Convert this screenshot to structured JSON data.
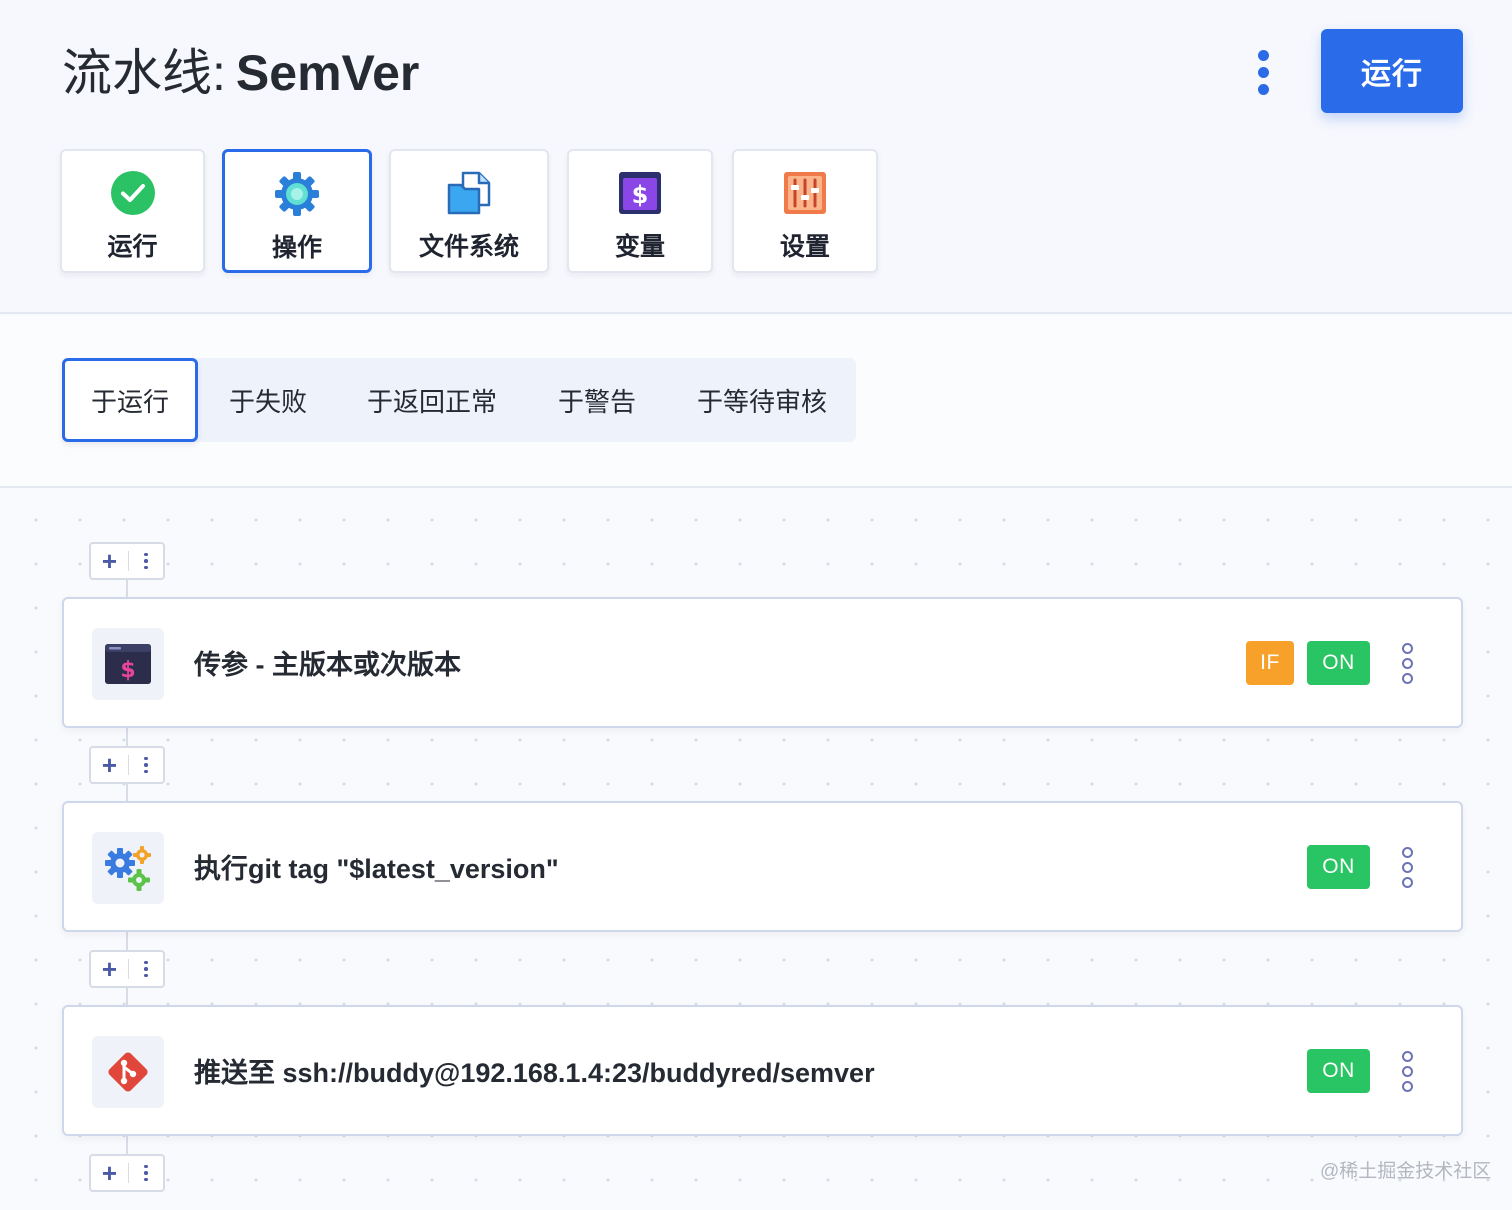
{
  "header": {
    "title_prefix": "流水线:",
    "title_name": "SemVer",
    "run_button": "运行",
    "more_icon": "kebab-vertical-icon"
  },
  "top_tabs": [
    {
      "label": "运行",
      "icon": "check-circle-icon",
      "active": false
    },
    {
      "label": "操作",
      "icon": "gear-icon",
      "active": true
    },
    {
      "label": "文件系统",
      "icon": "files-icon",
      "active": false
    },
    {
      "label": "变量",
      "icon": "dollar-icon",
      "active": false
    },
    {
      "label": "设置",
      "icon": "sliders-icon",
      "active": false
    }
  ],
  "trigger_tabs": [
    {
      "label": "于运行",
      "active": true
    },
    {
      "label": "于失败",
      "active": false
    },
    {
      "label": "于返回正常",
      "active": false
    },
    {
      "label": "于警告",
      "active": false
    },
    {
      "label": "于等待审核",
      "active": false
    }
  ],
  "actions": [
    {
      "name": "传参 - 主版本或次版本",
      "icon": "terminal-dollar-icon",
      "if_badge": "IF",
      "on_badge": "ON"
    },
    {
      "name": "执行git tag \"$latest_version\"",
      "icon": "gears-icon",
      "if_badge": null,
      "on_badge": "ON"
    },
    {
      "name": "推送至 ssh://buddy@192.168.1.4:23/buddyred/semver",
      "icon": "git-icon",
      "if_badge": null,
      "on_badge": "ON"
    }
  ],
  "adder": {
    "plus": "+"
  },
  "colors": {
    "accent": "#2a6bea",
    "on": "#29c463",
    "if": "#f7a12b"
  },
  "watermark": "@稀土掘金技术社区"
}
